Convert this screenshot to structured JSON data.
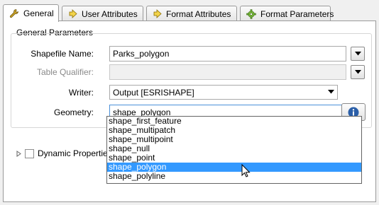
{
  "tabs": [
    {
      "label": "General",
      "icon": "wrench-icon",
      "active": true
    },
    {
      "label": "User Attributes",
      "icon": "arrow-right-icon",
      "active": false
    },
    {
      "label": "Format Attributes",
      "icon": "arrow-right-icon",
      "active": false
    },
    {
      "label": "Format Parameters",
      "icon": "gear-icon",
      "active": false
    }
  ],
  "general": {
    "group_title": "General Parameters",
    "shapefile_name": {
      "label": "Shapefile Name:",
      "value": "Parks_polygon"
    },
    "table_qualifier": {
      "label": "Table Qualifier:",
      "value": ""
    },
    "writer": {
      "label": "Writer:",
      "value": "Output [ESRISHAPE]"
    },
    "geometry": {
      "label": "Geometry:",
      "value": "shape_polygon"
    }
  },
  "dynamic_properties": {
    "label": "Dynamic Properties"
  },
  "geometry_options": [
    "shape_first_feature",
    "shape_multipatch",
    "shape_multipoint",
    "shape_null",
    "shape_point",
    "shape_polygon",
    "shape_polyline"
  ],
  "colors": {
    "selection": "#3399ff",
    "info_icon": "#2b5fa8"
  }
}
